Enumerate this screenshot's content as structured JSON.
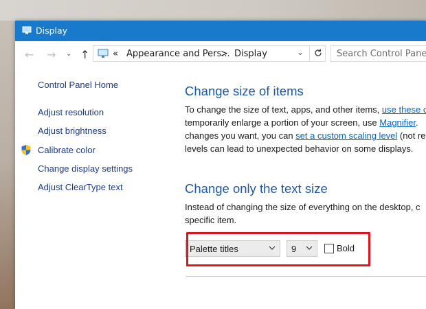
{
  "window": {
    "title": "Display"
  },
  "navigation": {
    "back_icon": "back-arrow-icon",
    "forward_icon": "forward-arrow-icon",
    "up_icon": "up-arrow-icon",
    "breadcrumb_prefix": "«",
    "breadcrumb": [
      "Appearance and Pers...",
      "Display"
    ],
    "separator": ">",
    "search_placeholder": "Search Control Panel"
  },
  "sidebar": {
    "home": "Control Panel Home",
    "items": [
      {
        "label": "Adjust resolution"
      },
      {
        "label": "Adjust brightness"
      },
      {
        "label": "Calibrate color",
        "icon": "shield-icon"
      },
      {
        "label": "Change display settings"
      },
      {
        "label": "Adjust ClearType text"
      }
    ]
  },
  "main": {
    "section1_title": "Change size of items",
    "section1_lines": [
      {
        "text": "To change the size of text, apps, and other items, ",
        "link": "use these c"
      },
      {
        "text": "temporarily enlarge a portion of your screen, use ",
        "link": "Magnifier",
        "after": "."
      },
      {
        "text": "changes you want, you can ",
        "link": "set a custom scaling level",
        "after": " (not re"
      },
      {
        "text": "levels can lead to unexpected behavior on some displays."
      }
    ],
    "section2_title": "Change only the text size",
    "section2_lines": [
      "Instead of changing the size of everything on the desktop, c",
      "specific item."
    ],
    "item_select": "Palette titles",
    "size_select": "9",
    "bold_label": "Bold",
    "bold_checked": false
  },
  "colors": {
    "titlebar": "#1979ca",
    "link": "#1a3c8a",
    "heading": "#1a5aa8",
    "highlight_box": "#e0141e"
  }
}
